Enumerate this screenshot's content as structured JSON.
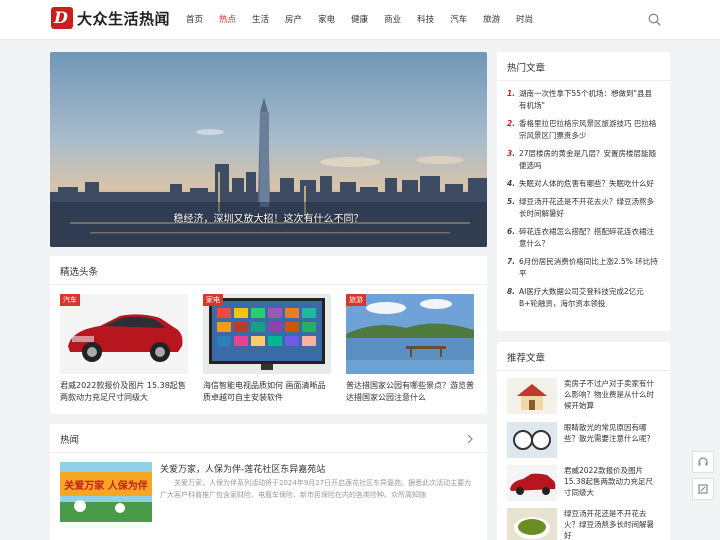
{
  "site": {
    "logo_text": "大众生活热闻",
    "logo_letter": "D"
  },
  "nav": {
    "items": [
      "首页",
      "热点",
      "生活",
      "房产",
      "家电",
      "健康",
      "商业",
      "科技",
      "汽车",
      "旅游",
      "时尚"
    ],
    "active": "热点"
  },
  "banner": {
    "caption": "稳经济，深圳又放大招！这次有什么不同？"
  },
  "featured": {
    "title": "精选头条",
    "items": [
      {
        "tag": "汽车",
        "caption": "君威2022款报价及图片 15.38起售 两款动力充足尺寸同级大"
      },
      {
        "tag": "家电",
        "caption": "海信智能电视品质如何 画面清晰品质卓越可自主安装软件"
      },
      {
        "tag": "旅游",
        "caption": "普达措国家公园有哪些景点？游览普达措国家公园注意什么"
      }
    ]
  },
  "hot": {
    "title": "热闻",
    "item": {
      "headline": "关爱万家，人保为伴-莲花社区东异嘉苑站",
      "summary": "关爱万家，人保为伴系列活动将于2024年9月27日开启莲花社区东异嘉苑。据悉此次活动主要为广大客户科普推广包含家财险、电瓶车保险、新市民保险在内的各类险种。众所周知随",
      "image_text": "关爱万家 人保为伴"
    }
  },
  "hot_articles": {
    "title": "热门文章",
    "items": [
      "湖南一次性拿下55个机场：想做到\"县县有机场\"",
      "香格里拉巴拉格宗风景区旅游技巧 巴拉格宗风景区门票贵多少",
      "27层楼房的黄金是几层？安置房楼层能随便选吗",
      "失眠对人体的危害有哪些？失眠吃什么好",
      "绿豆汤开花还是不开花去火？绿豆汤熬多长时间解暑好",
      "碎花连衣裙怎么搭配？搭配碎花连衣裙注意什么？",
      "6月份居民消费价格同比上涨2.5% 环比持平",
      "AI医疗大数据公司艾登科技完成2亿元B+轮融资，海尔资本领投"
    ]
  },
  "recommended": {
    "title": "推荐文章",
    "items": [
      "卖房子不过户对于卖家有什么影响？物业费是从什么时候开始算",
      "眼睛散光的常见原因有哪些？散光需要注意什么呢？",
      "君威2022款报价及图片 15.38起售两款动力充足尺寸同级大",
      "绿豆汤开花还是不开花去火？绿豆汤熬多长时间解暑好"
    ]
  },
  "colors": {
    "accent": "#d22222",
    "bg": "#f2f3f5"
  }
}
